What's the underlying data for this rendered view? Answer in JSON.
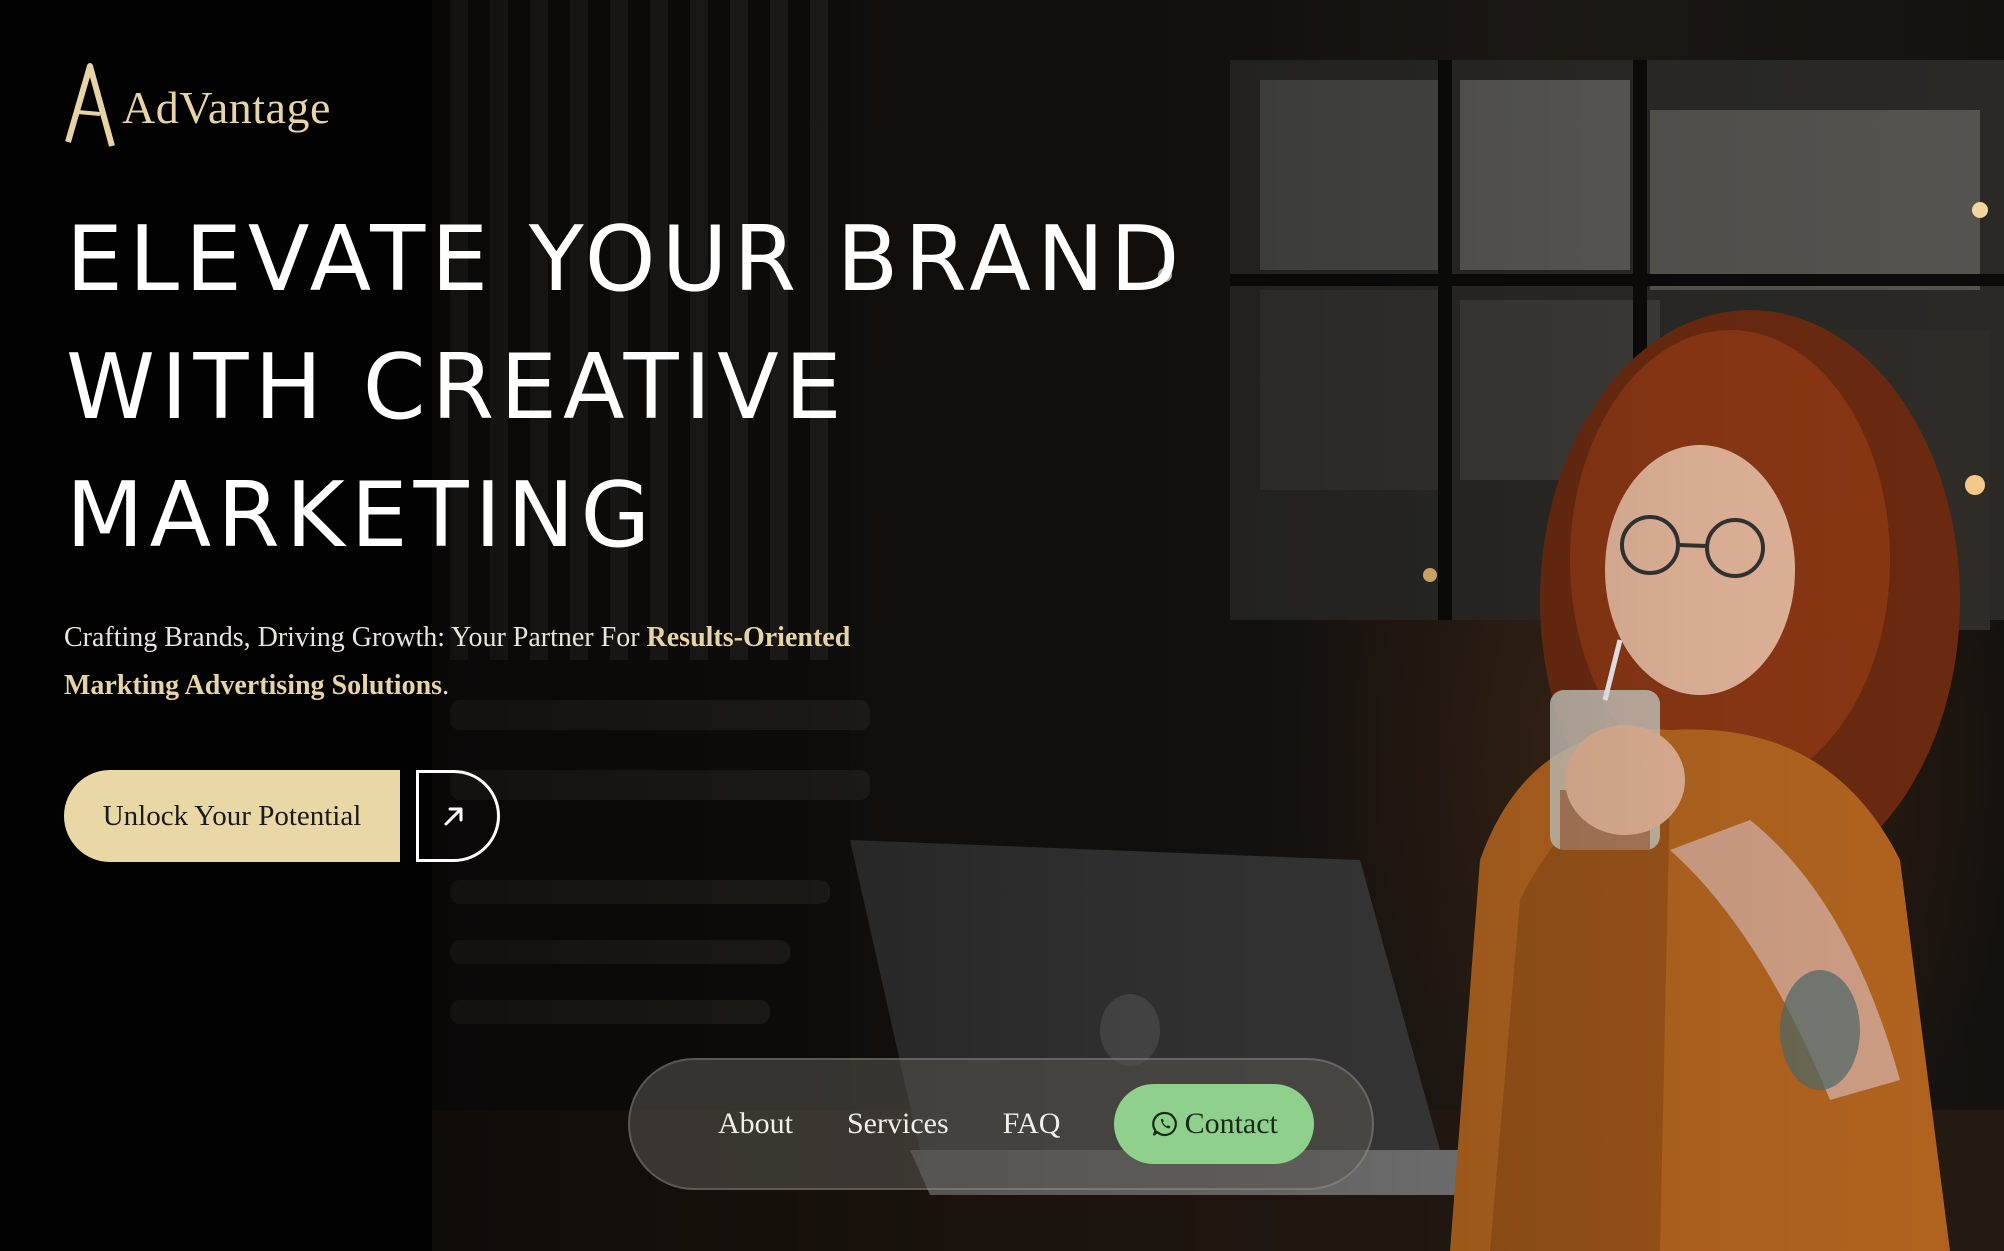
{
  "brand": {
    "name": "AdVantage",
    "accent_color": "#e6d4a6"
  },
  "hero": {
    "headline_lines": [
      "ELEVATE YOUR BRAND",
      "WITH CREATIVE",
      "MARKETING"
    ],
    "subtitle_lead": "Crafting Brands, Driving Growth: Your Partner For ",
    "subtitle_highlight_1": "Results-Oriented",
    "subtitle_highlight_2": "Markting Advertising Solutions",
    "subtitle_end": ".",
    "cta_label": "Unlock Your Potential",
    "cta_icon": "arrow-up-right-icon",
    "background": "photo of woman with curly red hair drinking iced coffee at laptop in cafe"
  },
  "nav": {
    "items": [
      {
        "label": "About"
      },
      {
        "label": "Services"
      },
      {
        "label": "FAQ"
      }
    ],
    "contact_label": "Contact",
    "contact_icon": "whatsapp-icon",
    "contact_color": "#8fd18c"
  }
}
